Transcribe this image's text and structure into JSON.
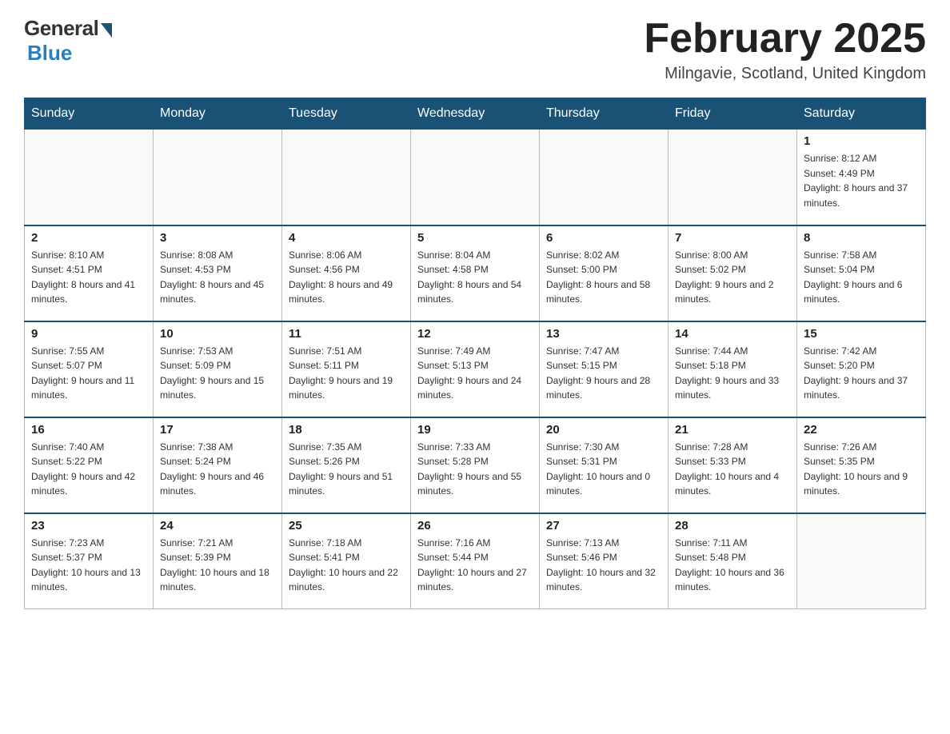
{
  "logo": {
    "general": "General",
    "blue": "Blue"
  },
  "header": {
    "title": "February 2025",
    "subtitle": "Milngavie, Scotland, United Kingdom"
  },
  "weekdays": [
    "Sunday",
    "Monday",
    "Tuesday",
    "Wednesday",
    "Thursday",
    "Friday",
    "Saturday"
  ],
  "weeks": [
    [
      {
        "day": "",
        "info": ""
      },
      {
        "day": "",
        "info": ""
      },
      {
        "day": "",
        "info": ""
      },
      {
        "day": "",
        "info": ""
      },
      {
        "day": "",
        "info": ""
      },
      {
        "day": "",
        "info": ""
      },
      {
        "day": "1",
        "info": "Sunrise: 8:12 AM\nSunset: 4:49 PM\nDaylight: 8 hours and 37 minutes."
      }
    ],
    [
      {
        "day": "2",
        "info": "Sunrise: 8:10 AM\nSunset: 4:51 PM\nDaylight: 8 hours and 41 minutes."
      },
      {
        "day": "3",
        "info": "Sunrise: 8:08 AM\nSunset: 4:53 PM\nDaylight: 8 hours and 45 minutes."
      },
      {
        "day": "4",
        "info": "Sunrise: 8:06 AM\nSunset: 4:56 PM\nDaylight: 8 hours and 49 minutes."
      },
      {
        "day": "5",
        "info": "Sunrise: 8:04 AM\nSunset: 4:58 PM\nDaylight: 8 hours and 54 minutes."
      },
      {
        "day": "6",
        "info": "Sunrise: 8:02 AM\nSunset: 5:00 PM\nDaylight: 8 hours and 58 minutes."
      },
      {
        "day": "7",
        "info": "Sunrise: 8:00 AM\nSunset: 5:02 PM\nDaylight: 9 hours and 2 minutes."
      },
      {
        "day": "8",
        "info": "Sunrise: 7:58 AM\nSunset: 5:04 PM\nDaylight: 9 hours and 6 minutes."
      }
    ],
    [
      {
        "day": "9",
        "info": "Sunrise: 7:55 AM\nSunset: 5:07 PM\nDaylight: 9 hours and 11 minutes."
      },
      {
        "day": "10",
        "info": "Sunrise: 7:53 AM\nSunset: 5:09 PM\nDaylight: 9 hours and 15 minutes."
      },
      {
        "day": "11",
        "info": "Sunrise: 7:51 AM\nSunset: 5:11 PM\nDaylight: 9 hours and 19 minutes."
      },
      {
        "day": "12",
        "info": "Sunrise: 7:49 AM\nSunset: 5:13 PM\nDaylight: 9 hours and 24 minutes."
      },
      {
        "day": "13",
        "info": "Sunrise: 7:47 AM\nSunset: 5:15 PM\nDaylight: 9 hours and 28 minutes."
      },
      {
        "day": "14",
        "info": "Sunrise: 7:44 AM\nSunset: 5:18 PM\nDaylight: 9 hours and 33 minutes."
      },
      {
        "day": "15",
        "info": "Sunrise: 7:42 AM\nSunset: 5:20 PM\nDaylight: 9 hours and 37 minutes."
      }
    ],
    [
      {
        "day": "16",
        "info": "Sunrise: 7:40 AM\nSunset: 5:22 PM\nDaylight: 9 hours and 42 minutes."
      },
      {
        "day": "17",
        "info": "Sunrise: 7:38 AM\nSunset: 5:24 PM\nDaylight: 9 hours and 46 minutes."
      },
      {
        "day": "18",
        "info": "Sunrise: 7:35 AM\nSunset: 5:26 PM\nDaylight: 9 hours and 51 minutes."
      },
      {
        "day": "19",
        "info": "Sunrise: 7:33 AM\nSunset: 5:28 PM\nDaylight: 9 hours and 55 minutes."
      },
      {
        "day": "20",
        "info": "Sunrise: 7:30 AM\nSunset: 5:31 PM\nDaylight: 10 hours and 0 minutes."
      },
      {
        "day": "21",
        "info": "Sunrise: 7:28 AM\nSunset: 5:33 PM\nDaylight: 10 hours and 4 minutes."
      },
      {
        "day": "22",
        "info": "Sunrise: 7:26 AM\nSunset: 5:35 PM\nDaylight: 10 hours and 9 minutes."
      }
    ],
    [
      {
        "day": "23",
        "info": "Sunrise: 7:23 AM\nSunset: 5:37 PM\nDaylight: 10 hours and 13 minutes."
      },
      {
        "day": "24",
        "info": "Sunrise: 7:21 AM\nSunset: 5:39 PM\nDaylight: 10 hours and 18 minutes."
      },
      {
        "day": "25",
        "info": "Sunrise: 7:18 AM\nSunset: 5:41 PM\nDaylight: 10 hours and 22 minutes."
      },
      {
        "day": "26",
        "info": "Sunrise: 7:16 AM\nSunset: 5:44 PM\nDaylight: 10 hours and 27 minutes."
      },
      {
        "day": "27",
        "info": "Sunrise: 7:13 AM\nSunset: 5:46 PM\nDaylight: 10 hours and 32 minutes."
      },
      {
        "day": "28",
        "info": "Sunrise: 7:11 AM\nSunset: 5:48 PM\nDaylight: 10 hours and 36 minutes."
      },
      {
        "day": "",
        "info": ""
      }
    ]
  ]
}
